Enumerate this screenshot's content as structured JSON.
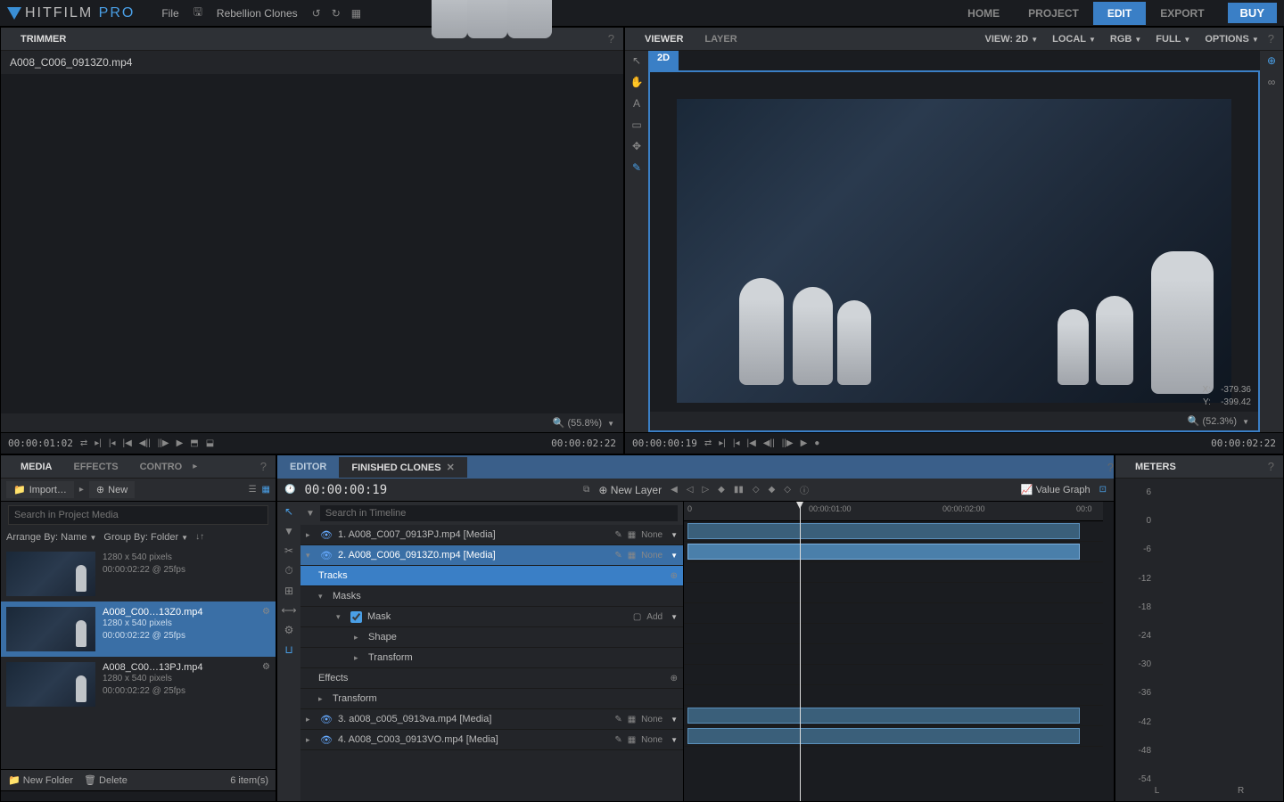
{
  "app": {
    "name_left": "HITFILM ",
    "name_right": "PRO"
  },
  "menu": {
    "file": "File",
    "project_name": "Rebellion Clones"
  },
  "top_tabs": {
    "home": "HOME",
    "project": "PROJECT",
    "edit": "EDIT",
    "export": "EXPORT"
  },
  "buy": "BUY",
  "trimmer": {
    "title": "TRIMMER",
    "filename": "A008_C006_0913Z0.mp4",
    "zoom": "(55.8%)",
    "tc_in": "00:00:01:02",
    "tc_out": "00:00:02:22"
  },
  "viewer": {
    "tab_viewer": "VIEWER",
    "tab_layer": "LAYER",
    "view_label": "VIEW: 2D",
    "local": "LOCAL",
    "rgb": "RGB",
    "full": "FULL",
    "options": "OPTIONS",
    "tab_2d": "2D",
    "coord_x_label": "X:",
    "coord_x": "-379.36",
    "coord_y_label": "Y:",
    "coord_y": "-399.42",
    "zoom": "(52.3%)",
    "tc_in": "00:00:00:19",
    "tc_out": "00:00:02:22"
  },
  "media": {
    "tab_media": "MEDIA",
    "tab_effects": "EFFECTS",
    "tab_contro": "CONTRO",
    "import": "Import…",
    "new": "New",
    "search_placeholder": "Search in Project Media",
    "arrange": "Arrange By: Name",
    "group": "Group By: Folder",
    "items": [
      {
        "name": "",
        "dims": "1280 x 540 pixels",
        "dur": "00:00:02:22 @ 25fps"
      },
      {
        "name": "A008_C00…13Z0.mp4",
        "dims": "1280 x 540 pixels",
        "dur": "00:00:02:22 @ 25fps"
      },
      {
        "name": "A008_C00…13PJ.mp4",
        "dims": "1280 x 540 pixels",
        "dur": "00:00:02:22 @ 25fps"
      }
    ],
    "new_folder": "New Folder",
    "delete": "Delete",
    "count": "6 item(s)"
  },
  "editor": {
    "tab_editor": "EDITOR",
    "tab_finished": "FINISHED CLONES",
    "tc": "00:00:00:19",
    "new_layer": "New Layer",
    "value_graph": "Value Graph",
    "search_placeholder": "Search in Timeline",
    "ruler": {
      "t0": "0",
      "t1": "00:00:01:00",
      "t2": "00:00:02:00",
      "t3": "00:0"
    },
    "layers": {
      "l1": "1. A008_C007_0913PJ.mp4 [Media]",
      "l2": "2. A008_C006_0913Z0.mp4 [Media]",
      "tracks": "Tracks",
      "masks": "Masks",
      "mask": "Mask",
      "add": "Add",
      "shape": "Shape",
      "transform": "Transform",
      "effects": "Effects",
      "transform2": "Transform",
      "l3": "3. a008_c005_0913va.mp4 [Media]",
      "l4": "4. A008_C003_0913VO.mp4 [Media]",
      "none": "None"
    }
  },
  "meters": {
    "title": "METERS",
    "ticks": [
      "6",
      "0",
      "-6",
      "-12",
      "-18",
      "-24",
      "-30",
      "-36",
      "-42",
      "-48",
      "-54"
    ],
    "L": "L",
    "R": "R"
  }
}
